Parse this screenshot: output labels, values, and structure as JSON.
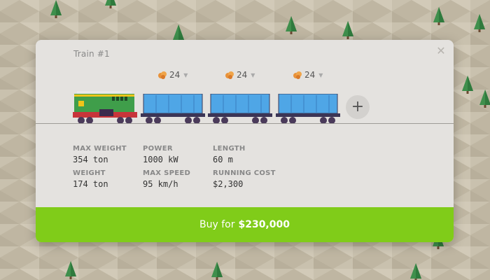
{
  "dialog": {
    "title": "Train #1",
    "close_icon": "close-icon"
  },
  "consist": {
    "locomotive_colors": {
      "body": "#3f9e4a",
      "stripe": "#f0c419",
      "base": "#c8343a",
      "roof": "#e8e8e8"
    },
    "wagon_color": "#4fa6e6",
    "cargo_icon": "ore-icon",
    "wagons": [
      {
        "cargo_count": "24"
      },
      {
        "cargo_count": "24"
      },
      {
        "cargo_count": "24"
      }
    ],
    "add_label": "+"
  },
  "stats": {
    "max_weight": {
      "label": "MAX WEIGHT",
      "value": "354 ton"
    },
    "weight": {
      "label": "WEIGHT",
      "value": "174 ton"
    },
    "power": {
      "label": "POWER",
      "value": "1000 kW"
    },
    "max_speed": {
      "label": "MAX SPEED",
      "value": "95 km/h"
    },
    "length": {
      "label": "LENGTH",
      "value": "60 m"
    },
    "running_cost": {
      "label": "RUNNING COST",
      "value": "$2,300"
    }
  },
  "buy": {
    "prefix": "Buy for",
    "price": "$230,000",
    "color": "#80cc19"
  }
}
